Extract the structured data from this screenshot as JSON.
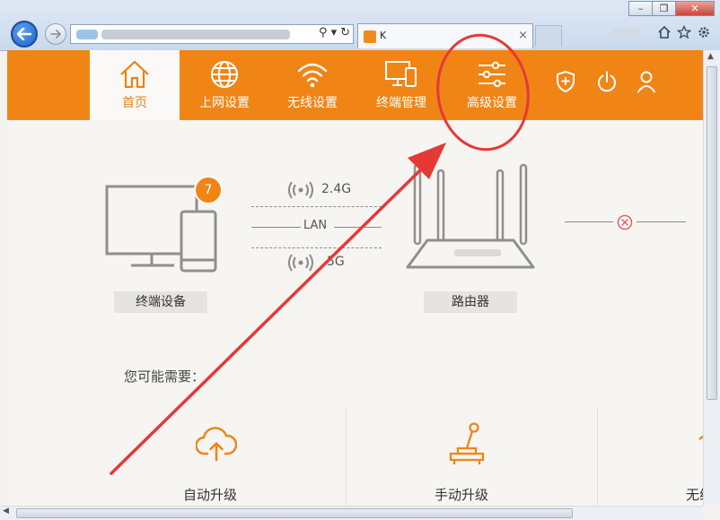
{
  "browser": {
    "tab_title": "K",
    "tab_close": "×",
    "window_controls": {
      "minimize": "–",
      "restore": "❐",
      "close": "✕"
    },
    "address_tools": {
      "search": "⚲",
      "dropdown": "▾",
      "refresh": "↻"
    },
    "icons": [
      "back-arrow-icon",
      "forward-arrow-icon",
      "home-icon",
      "star-icon",
      "gear-icon"
    ]
  },
  "nav": {
    "items": [
      {
        "label": "首页",
        "icon": "home-icon"
      },
      {
        "label": "上网设置",
        "icon": "globe-icon"
      },
      {
        "label": "无线设置",
        "icon": "wifi-icon"
      },
      {
        "label": "终端管理",
        "icon": "devices-icon"
      },
      {
        "label": "高级设置",
        "icon": "sliders-icon"
      }
    ],
    "tools": [
      "shield-plus-icon",
      "power-icon",
      "user-icon"
    ]
  },
  "topology": {
    "device_badge": "7",
    "device_label": "终端设备",
    "band_24": "2.4G",
    "lan": "LAN",
    "band_5": "5G",
    "router_label": "路由器",
    "wan_status_icon": "disconnected-icon"
  },
  "hint": "您可能需要：",
  "tools": [
    {
      "label": "自动升级",
      "icon": "cloud-upload-icon"
    },
    {
      "label": "手动升级",
      "icon": "joystick-icon"
    },
    {
      "label": "无线",
      "icon": "wifi-icon"
    }
  ],
  "colors": {
    "accent": "#f08516",
    "annotation_red": "#e53935",
    "badge": "#f08516"
  }
}
